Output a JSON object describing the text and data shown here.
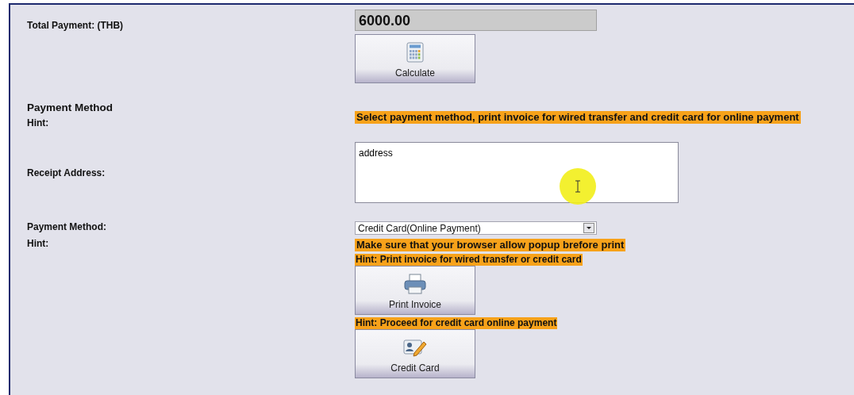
{
  "total_payment": {
    "label": "Total Payment: (THB)",
    "value": "6000.00"
  },
  "calculate_button": {
    "label": "Calculate"
  },
  "payment_section": {
    "title": "Payment Method",
    "hint_label": "Hint:",
    "hint": "Select payment method, print invoice for wired transfer and credit card for online payment"
  },
  "receipt_address": {
    "label": "Receipt Address:",
    "value": "address"
  },
  "payment_method": {
    "label": "Payment Method:",
    "value": "Credit Card(Online Payment)",
    "hint_label": "Hint:",
    "hint": "Make sure that your browser allow popup brefore print"
  },
  "actions": [
    {
      "kind": "print",
      "hint": "Hint: Print invoice for wired transfer or credit card",
      "label": "Print Invoice"
    },
    {
      "kind": "card",
      "hint": "Hint: Proceed for credit card online payment",
      "label": "Credit Card"
    }
  ]
}
